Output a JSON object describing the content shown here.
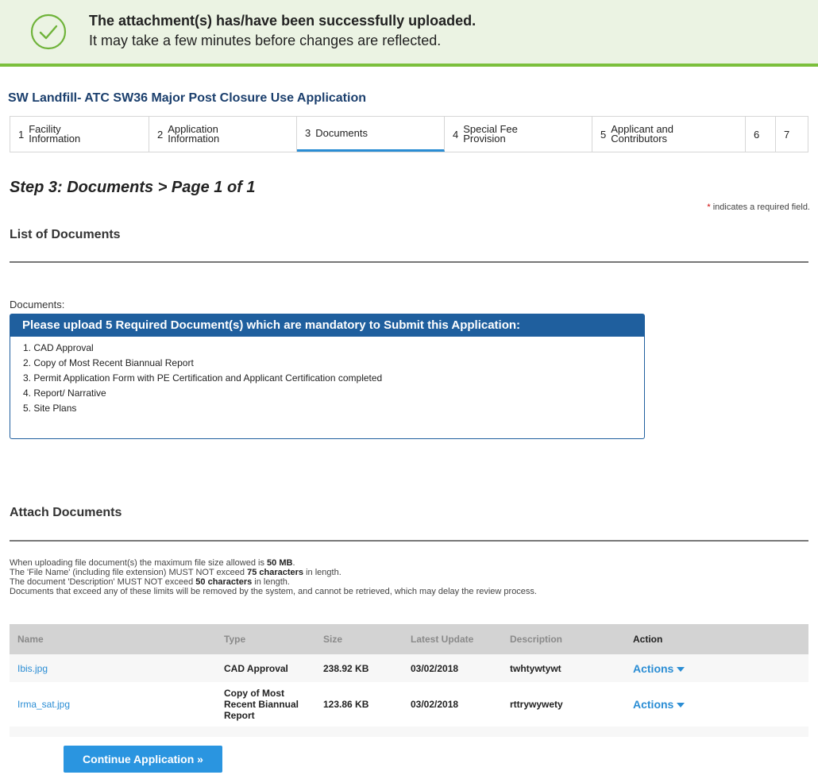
{
  "banner": {
    "line1": "The attachment(s) has/have been successfully uploaded.",
    "line2": "It may take a few minutes before changes are reflected."
  },
  "app_title": "SW Landfill- ATC SW36 Major Post Closure Use Application",
  "steps": [
    {
      "num": "1",
      "label1": "Facility",
      "label2": "Information"
    },
    {
      "num": "2",
      "label1": "Application",
      "label2": "Information"
    },
    {
      "num": "3",
      "label1": "Documents",
      "label2": ""
    },
    {
      "num": "4",
      "label1": "Special Fee",
      "label2": "Provision"
    },
    {
      "num": "5",
      "label1": "Applicant and",
      "label2": "Contributors"
    },
    {
      "num": "6",
      "label1": "",
      "label2": ""
    },
    {
      "num": "7",
      "label1": "",
      "label2": ""
    }
  ],
  "step_heading": "Step 3: Documents > Page 1 of 1",
  "required_note": {
    "star": "*",
    "text": " indicates a required field."
  },
  "list_title": "List of Documents",
  "documents_label": "Documents:",
  "required_box": {
    "header": "Please upload 5 Required Document(s) which are mandatory to Submit this Application:",
    "items": [
      "1. CAD Approval",
      "2. Copy of Most Recent Biannual Report",
      "3. Permit Application Form with PE Certification and Applicant Certification completed",
      "4. Report/ Narrative",
      "5. Site Plans"
    ]
  },
  "attach_title": "Attach Documents",
  "info": {
    "l1a": "When uploading file document(s) the maximum file size allowed is ",
    "l1b": "50 MB",
    "l1c": ".",
    "l2a": "The 'File Name' (including file extension) MUST NOT exceed ",
    "l2b": "75 characters",
    "l2c": " in length.",
    "l3a": "The document 'Description' MUST NOT exceed ",
    "l3b": "50 characters",
    "l3c": " in length.",
    "l4": "Documents that exceed any of these limits will be removed by the system, and cannot be retrieved, which may delay the review process."
  },
  "table": {
    "headers": [
      "Name",
      "Type",
      "Size",
      "Latest Update",
      "Description",
      "Action"
    ],
    "rows": [
      {
        "name": "Ibis.jpg",
        "type": "CAD Approval",
        "size": "238.92 KB",
        "date": "03/02/2018",
        "desc": "twhtywtywt",
        "action": "Actions"
      },
      {
        "name": "Irma_sat.jpg",
        "type1": "Copy of Most",
        "type2": "Recent Biannual",
        "type3": "Report",
        "size": "123.86 KB",
        "date": "03/02/2018",
        "desc": "rttrywywety",
        "action": "Actions"
      }
    ]
  },
  "continue_label": "Continue Application »",
  "colors": {
    "accent": "#2a8dd4",
    "success": "#7bbf3c",
    "header_blue": "#1f5f9e"
  }
}
